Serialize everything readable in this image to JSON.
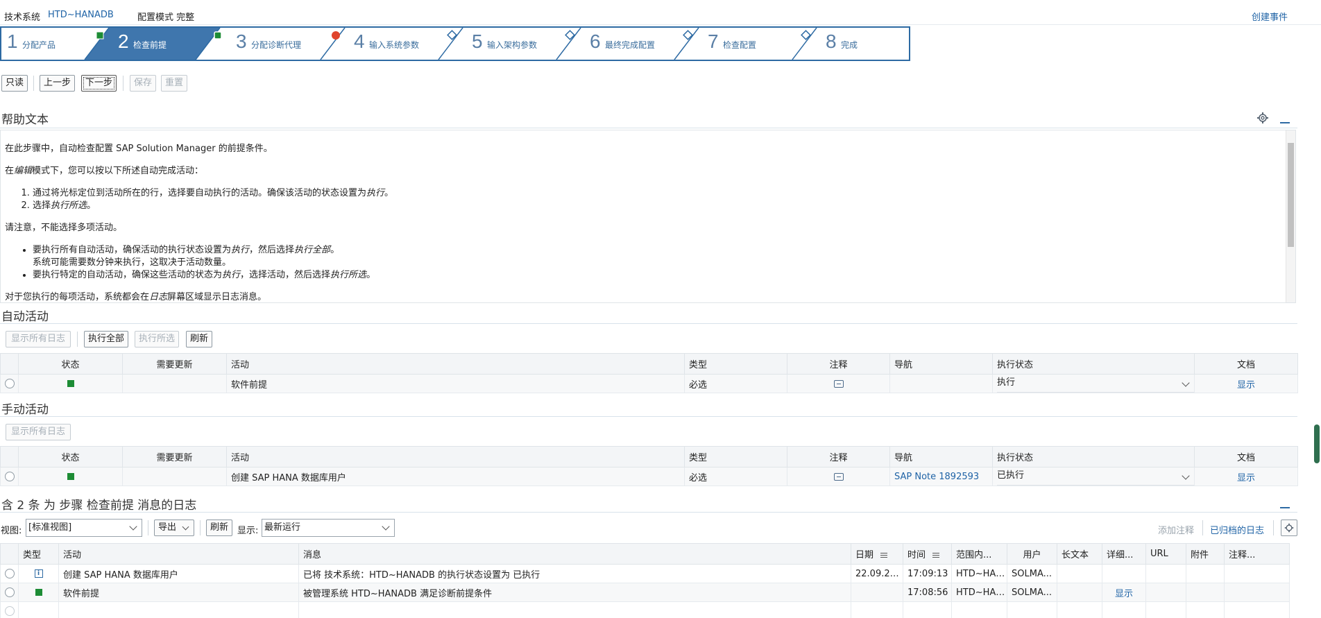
{
  "header": {
    "system_label": "技术系统",
    "system_name": "HTD~HANADB",
    "mode_label": "配置模式 完整",
    "create_event": "创建事件"
  },
  "roadmap": {
    "steps": [
      {
        "num": "1",
        "label": "分配产品",
        "status": "green"
      },
      {
        "num": "2",
        "label": "检查前提",
        "status": "green"
      },
      {
        "num": "3",
        "label": "分配诊断代理",
        "status": "red"
      },
      {
        "num": "4",
        "label": "输入系统参数",
        "status": "none"
      },
      {
        "num": "5",
        "label": "输入架构参数",
        "status": "none"
      },
      {
        "num": "6",
        "label": "最终完成配置",
        "status": "none"
      },
      {
        "num": "7",
        "label": "检查配置",
        "status": "none"
      },
      {
        "num": "8",
        "label": "完成",
        "status": "none"
      }
    ],
    "active_step": 2
  },
  "toolbar": {
    "readonly": "只读",
    "prev": "上一步",
    "next": "下一步",
    "save": "保存",
    "reset": "重置"
  },
  "help": {
    "title": "帮助文本",
    "p1": "在此步骤中，自动检查配置 SAP Solution Manager 的前提条件。",
    "p2_a": "在",
    "p2_em": "编辑",
    "p2_b": "模式下，您可以按以下所述自动完成活动：",
    "ol1_a": "通过将光标定位到活动所在的行，选择要自动执行的活动。确保该活动的状态设置为",
    "ol1_em": "执行",
    "ol1_b": "。",
    "ol2_a": "选择",
    "ol2_em": "执行所选",
    "ol2_b": "。",
    "p3": "请注意，不能选择多项活动。",
    "ul1_a": "要执行所有自动活动，确保活动的执行状态设置为",
    "ul1_em1": "执行",
    "ul1_b": "，然后选择",
    "ul1_em2": "执行全部",
    "ul1_c": "。",
    "ul1_line2": "系统可能需要数分钟来执行，这取决于活动数量。",
    "ul2_a": "要执行特定的自动活动，确保这些活动的状态为",
    "ul2_em1": "执行",
    "ul2_b": "，选择活动，然后选择",
    "ul2_em2": "执行所选",
    "ul2_c": "。",
    "p4_a": "对于您执行的每项活动，系统都会在",
    "p4_em": "日志",
    "p4_b": "屏幕区域显示日志消息。"
  },
  "auto": {
    "title": "自动活动",
    "btn_show_logs": "显示所有日志",
    "btn_exec_all": "执行全部",
    "btn_exec_sel": "执行所选",
    "btn_refresh": "刷新",
    "headers": [
      "状态",
      "需要更新",
      "活动",
      "类型",
      "注释",
      "导航",
      "执行状态",
      "文档"
    ],
    "rows": [
      {
        "activity": "软件前提",
        "type": "必选",
        "nav": "",
        "exec_status": "执行",
        "doc": "显示"
      }
    ]
  },
  "manual": {
    "title": "手动活动",
    "btn_show_logs": "显示所有日志",
    "headers": [
      "状态",
      "需要更新",
      "活动",
      "类型",
      "注释",
      "导航",
      "执行状态",
      "文档"
    ],
    "rows": [
      {
        "activity": "创建 SAP HANA 数据库用户",
        "type": "必选",
        "nav": "SAP Note 1892593",
        "exec_status": "已执行",
        "doc": "显示"
      }
    ]
  },
  "log": {
    "title": "含 2 条 为 步骤 检查前提 消息的日志",
    "view_label": "视图:",
    "view_value": "[标准视图]",
    "export": "导出",
    "refresh": "刷新",
    "show_label": "显示:",
    "show_value": "最新运行",
    "add_note": "添加注释",
    "archived": "已归档的日志",
    "headers": [
      "类型",
      "活动",
      "消息",
      "日期",
      "时间",
      "范围内...",
      "用户",
      "长文本",
      "详细...",
      "URL",
      "附件",
      "注释..."
    ],
    "rows": [
      {
        "icon": "info",
        "activity": "创建 SAP HANA 数据库用户",
        "message": "已将 技术系统：HTD~HANADB 的执行状态设置为 已执行",
        "date": "22.09.20...",
        "time": "17:09:13",
        "scope": "HTD~HAN...",
        "user": "SOLMA...",
        "detail": ""
      },
      {
        "icon": "green",
        "activity": "软件前提",
        "message": "被管理系统 HTD~HANADB 满足诊断前提条件",
        "date": "",
        "time": "17:08:56",
        "scope": "HTD~HAN...",
        "user": "SOLMA...",
        "detail": "显示"
      }
    ]
  },
  "colors": {
    "accent": "#2d6aa3",
    "link": "#1f63a6",
    "green": "#1d8c35",
    "red": "#e0442c"
  }
}
